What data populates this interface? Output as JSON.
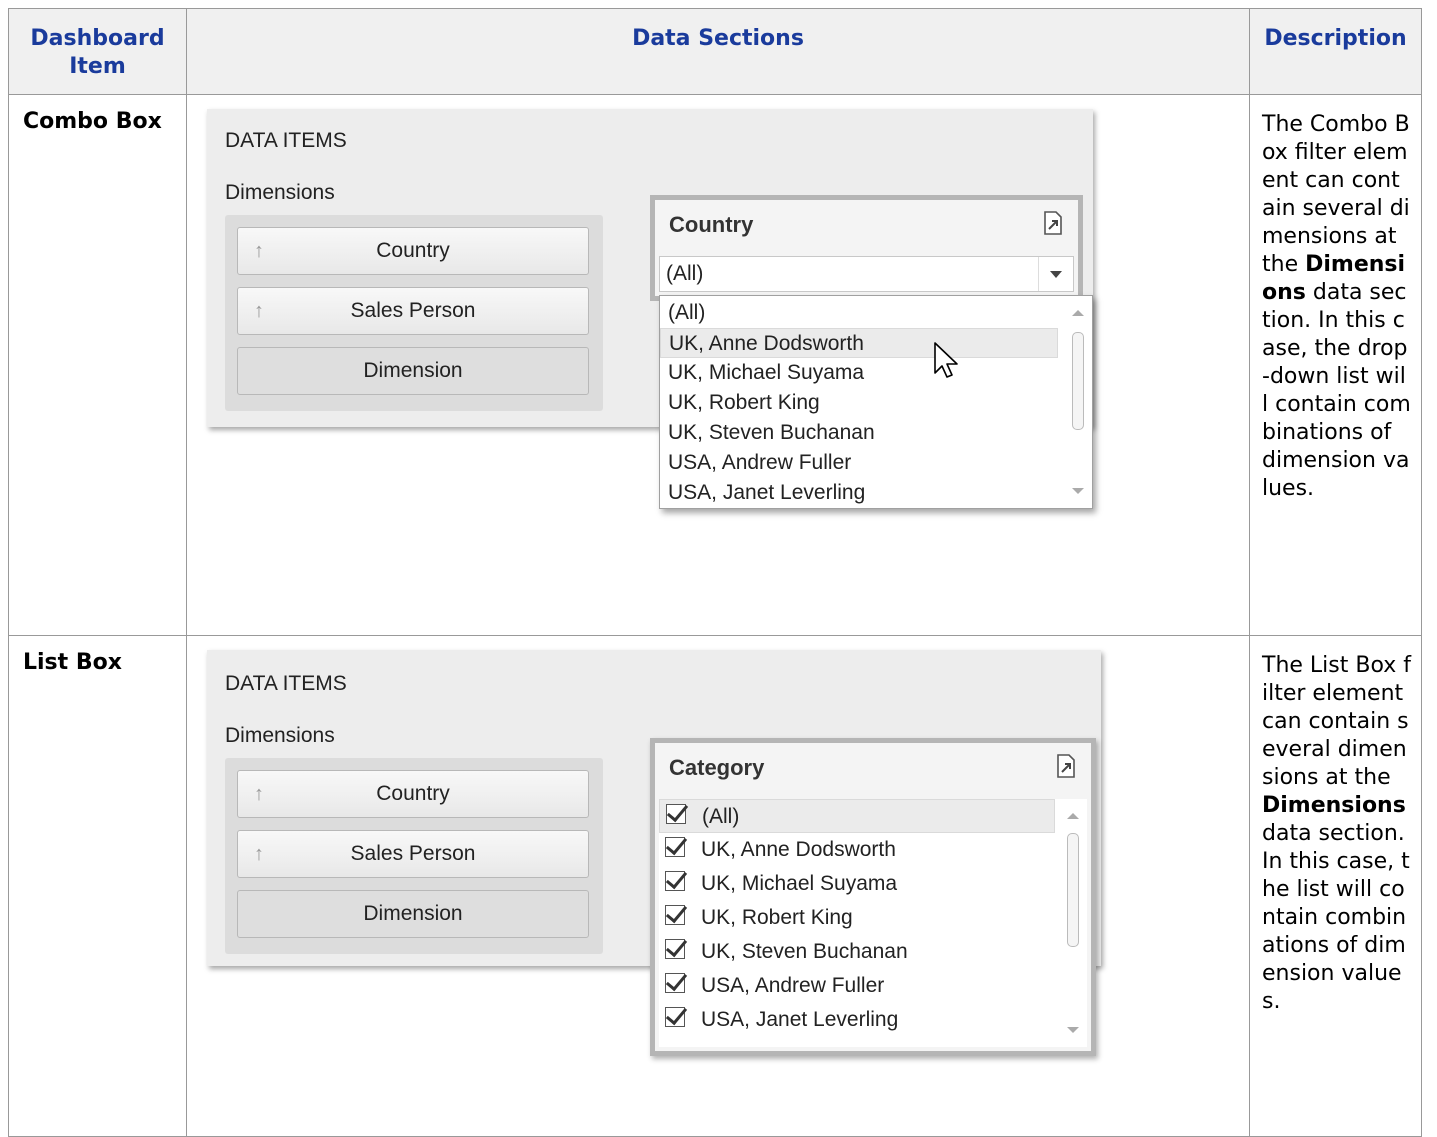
{
  "table": {
    "headers": {
      "item": "Dashboard Item",
      "sections": "Data Sections",
      "description": "Description"
    },
    "rows": [
      {
        "item": "Combo Box",
        "panel": {
          "data_items_label": "DATA ITEMS",
          "dimensions_label": "Dimensions",
          "dimensions": [
            "Country",
            "Sales Person",
            "Dimension"
          ]
        },
        "filter": {
          "title": "Country",
          "selected": "(All)",
          "options": [
            "(All)",
            "UK, Anne Dodsworth",
            "UK, Michael Suyama",
            "UK, Robert King",
            "UK, Steven Buchanan",
            "USA, Andrew Fuller",
            "USA, Janet Leverling"
          ]
        },
        "description": {
          "pre": "The Combo Box filter element can contain several dimensions at the ",
          "bold": "Dimensions",
          "post": " data section. In this case, the drop-down list will contain combinations of dimension values."
        }
      },
      {
        "item": "List Box",
        "panel": {
          "data_items_label": "DATA ITEMS",
          "dimensions_label": "Dimensions",
          "dimensions": [
            "Country",
            "Sales Person",
            "Dimension"
          ]
        },
        "filter": {
          "title": "Category",
          "options": [
            "(All)",
            "UK, Anne Dodsworth",
            "UK, Michael Suyama",
            "UK, Robert King",
            "UK, Steven Buchanan",
            "USA, Andrew Fuller",
            "USA, Janet Leverling"
          ]
        },
        "description": {
          "pre": "The List Box filter element can contain several dimensions at the ",
          "bold": "Dimensions",
          "post": " data section. In this case, the list will contain combinations of dimension values."
        }
      }
    ]
  },
  "icons": {
    "sort": "sort-ascending-icon",
    "export": "export-icon",
    "cursor": "mouse-cursor-icon",
    "check": "checkbox-checked-icon"
  }
}
